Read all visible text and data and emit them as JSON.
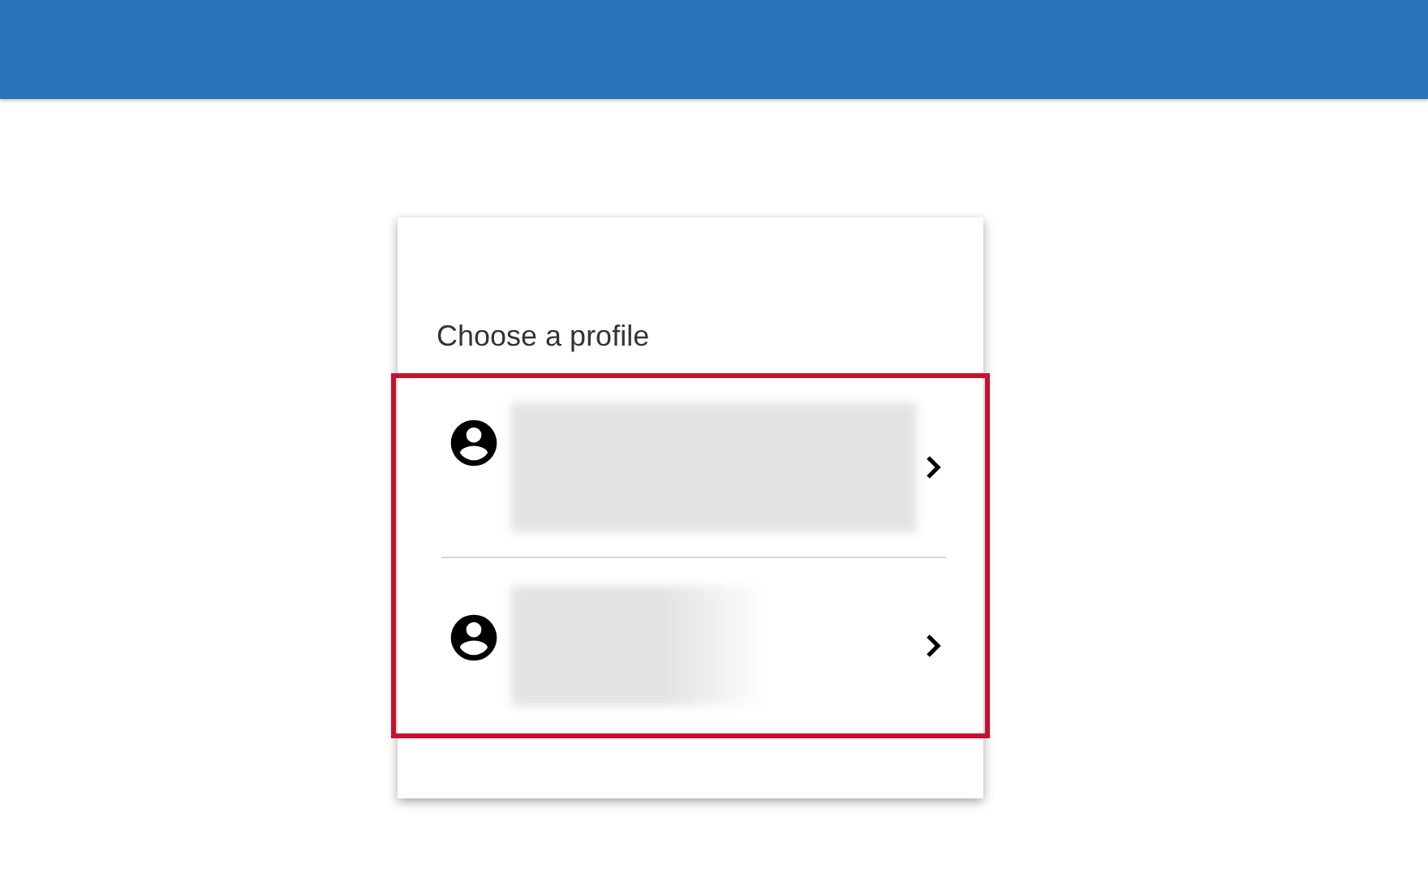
{
  "card": {
    "title": "Choose a profile",
    "highlighted": true,
    "profiles": [
      {
        "kind": "wide"
      },
      {
        "kind": "narrow"
      }
    ]
  }
}
